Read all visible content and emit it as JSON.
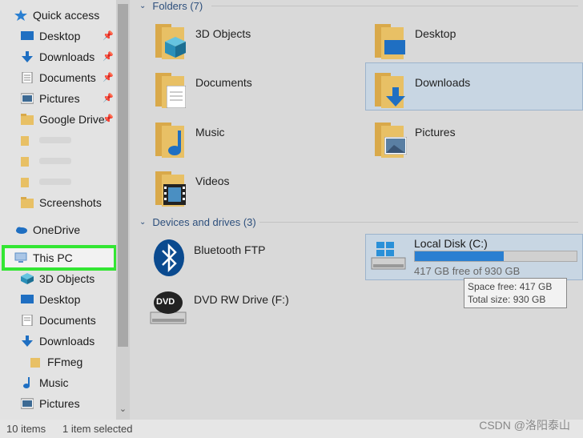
{
  "sidebar": {
    "quick_access": "Quick access",
    "items": [
      {
        "label": "Desktop",
        "pinned": true,
        "icon": "desktop-icon"
      },
      {
        "label": "Downloads",
        "pinned": true,
        "icon": "download-arrow-icon"
      },
      {
        "label": "Documents",
        "pinned": true,
        "icon": "documents-icon"
      },
      {
        "label": "Pictures",
        "pinned": true,
        "icon": "pictures-icon"
      },
      {
        "label": "Google Drive",
        "pinned": true,
        "icon": "folder-icon"
      },
      {
        "label": "Screenshots",
        "icon": "folder-icon"
      }
    ],
    "onedrive": "OneDrive",
    "this_pc": "This PC",
    "pc_items": [
      {
        "label": "3D Objects",
        "icon": "cube-icon"
      },
      {
        "label": "Desktop",
        "icon": "desktop-icon"
      },
      {
        "label": "Documents",
        "icon": "documents-icon"
      },
      {
        "label": "Downloads",
        "icon": "download-arrow-icon"
      },
      {
        "label": "FFmeg",
        "icon": "folder-icon"
      },
      {
        "label": "Music",
        "icon": "music-icon"
      },
      {
        "label": "Pictures",
        "icon": "pictures-icon"
      }
    ],
    "pin_glyph": "📌"
  },
  "main": {
    "folders_header": "Folders (7)",
    "folders": [
      {
        "label": "3D Objects"
      },
      {
        "label": "Desktop"
      },
      {
        "label": "Documents"
      },
      {
        "label": "Downloads"
      },
      {
        "label": "Music"
      },
      {
        "label": "Pictures"
      },
      {
        "label": "Videos"
      }
    ],
    "devices_header": "Devices and drives (3)",
    "devices": {
      "bluetooth": "Bluetooth FTP",
      "local_disk": "Local Disk (C:)",
      "local_disk_free": "417 GB free of 930 GB",
      "local_disk_used_fraction": 0.55,
      "dvd": "DVD RW Drive (F:)",
      "dvd_badge": "DVD"
    },
    "tooltip": {
      "line1": "Space free: 417 GB",
      "line2": "Total size: 930 GB"
    }
  },
  "status": {
    "items": "10 items",
    "selected": "1 item selected"
  },
  "watermark": "CSDN @洛阳泰山",
  "colors": {
    "accent": "#2a7fd1",
    "highlight": "#33e633",
    "folder": "#e8c065"
  }
}
